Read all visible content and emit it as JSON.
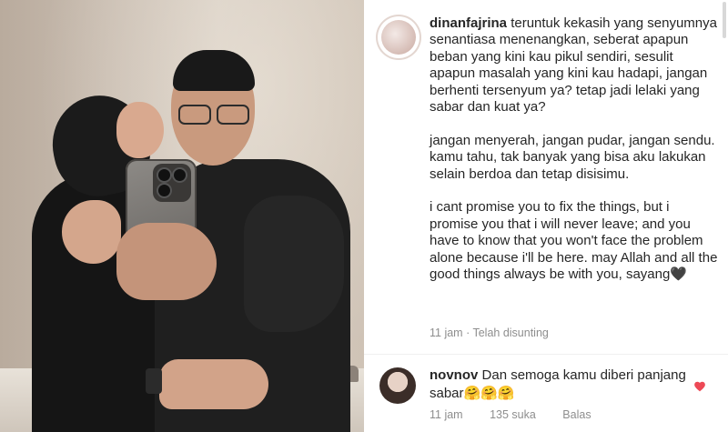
{
  "post": {
    "username": "dinanfajrina",
    "caption_paragraphs": [
      "teruntuk kekasih yang senyumnya senantiasa menenangkan, seberat apapun beban yang kini kau pikul sendiri, sesulit apapun masalah yang kini kau hadapi, jangan berhenti tersenyum ya? tetap jadi lelaki yang sabar dan kuat ya?",
      "jangan menyerah, jangan pudar, jangan sendu. kamu tahu, tak banyak yang bisa aku lakukan selain berdoa dan tetap disisimu.",
      "i cant promise you to fix the things, but i promise you that i will never leave; and you have to know that you won't face the problem alone because i'll be here. may Allah and all the good things always be with you, sayang🖤"
    ],
    "meta": "11 jam · Telah disunting"
  },
  "reply": {
    "username": "novnov",
    "text": "Dan semoga kamu diberi panjang sabar🤗🤗🤗",
    "time": "11 jam",
    "likes": "135 suka",
    "reply_label": "Balas"
  },
  "icons": {
    "like": "heart-icon",
    "like_color": "#ed4956"
  }
}
